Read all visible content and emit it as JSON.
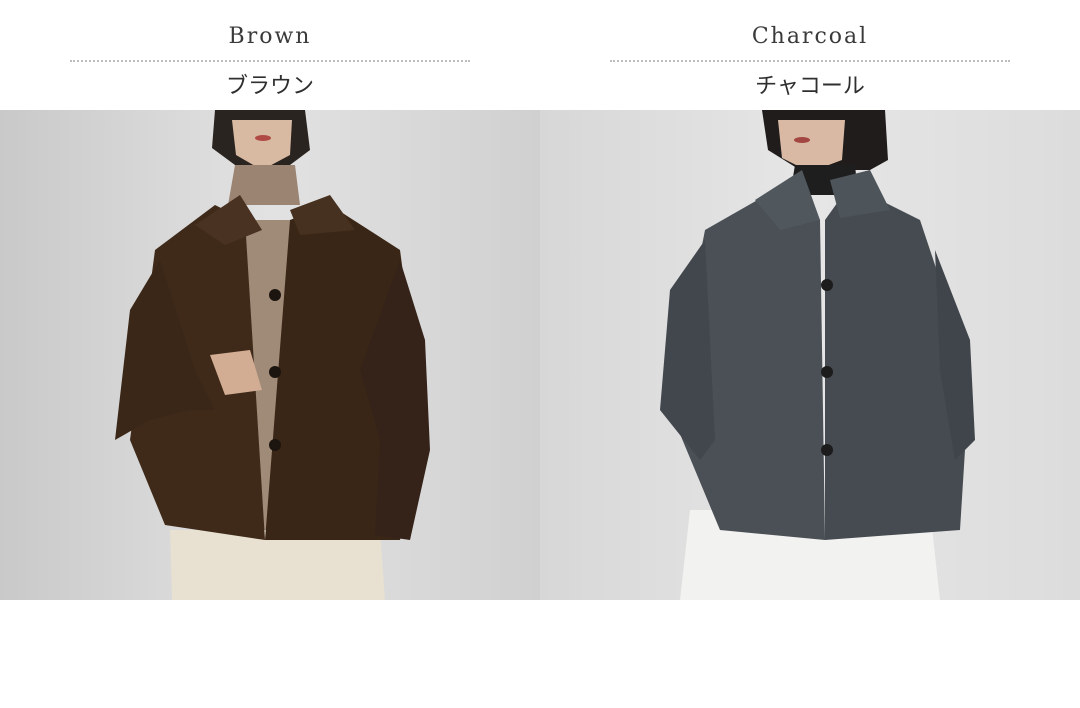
{
  "variants": [
    {
      "name_en": "Brown",
      "name_jp": "ブラウン",
      "coat_color": "#3f2a1a"
    },
    {
      "name_en": "Charcoal",
      "name_jp": "チャコール",
      "coat_color": "#4a5056"
    }
  ],
  "colors": {
    "background": "#ffffff",
    "divider": "#bdbdbd",
    "studio_bg": "#d8d8d8"
  }
}
